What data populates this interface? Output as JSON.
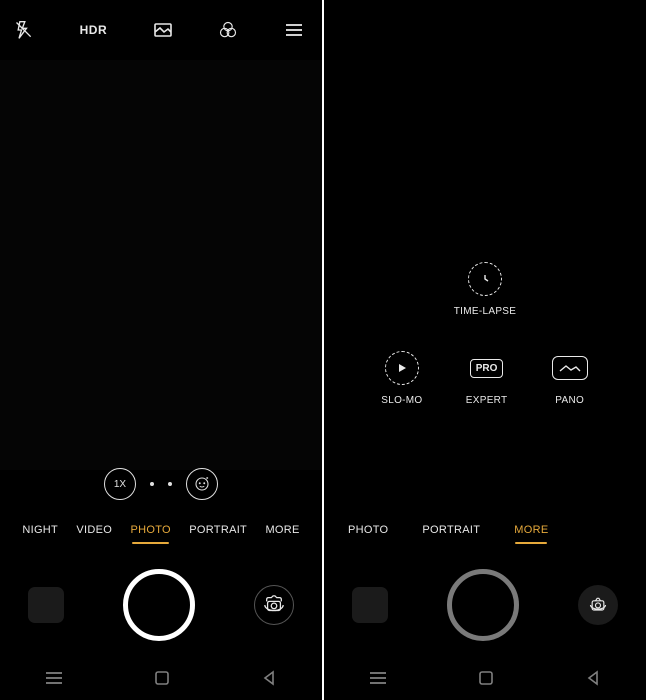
{
  "left": {
    "topbar": {
      "flash_icon": "flash-off-icon",
      "hdr_label": "HDR",
      "aspect_icon": "aspect-ratio-icon",
      "filter_icon": "filter-icon",
      "menu_icon": "menu-icon"
    },
    "zoom": {
      "label": "1X",
      "beauty_icon": "face-beauty-icon"
    },
    "modes": [
      {
        "label": "NIGHT",
        "active": false
      },
      {
        "label": "VIDEO",
        "active": false
      },
      {
        "label": "PHOTO",
        "active": true
      },
      {
        "label": "PORTRAIT",
        "active": false
      },
      {
        "label": "MORE",
        "active": false
      }
    ],
    "controls": {
      "thumb_icon": "gallery-thumb",
      "shutter_icon": "shutter-button",
      "switch_icon": "switch-camera-icon"
    }
  },
  "right": {
    "more_modes_top": [
      {
        "label": "TIME-LAPSE",
        "icon": "timelapse-icon"
      }
    ],
    "more_modes_row": [
      {
        "label": "SLO-MO",
        "icon": "slomo-icon"
      },
      {
        "label": "EXPERT",
        "icon": "pro-icon",
        "badge": "PRO"
      },
      {
        "label": "PANO",
        "icon": "pano-icon"
      }
    ],
    "modes": [
      {
        "label": "PHOTO",
        "active": false
      },
      {
        "label": "PORTRAIT",
        "active": false
      },
      {
        "label": "MORE",
        "active": true
      }
    ],
    "controls": {
      "thumb_icon": "gallery-thumb",
      "shutter_icon": "shutter-button",
      "switch_icon": "switch-camera-icon"
    }
  },
  "nav": {
    "recent_icon": "nav-recent-icon",
    "back_icon": "nav-back-icon",
    "home_icon": "nav-home-icon"
  }
}
